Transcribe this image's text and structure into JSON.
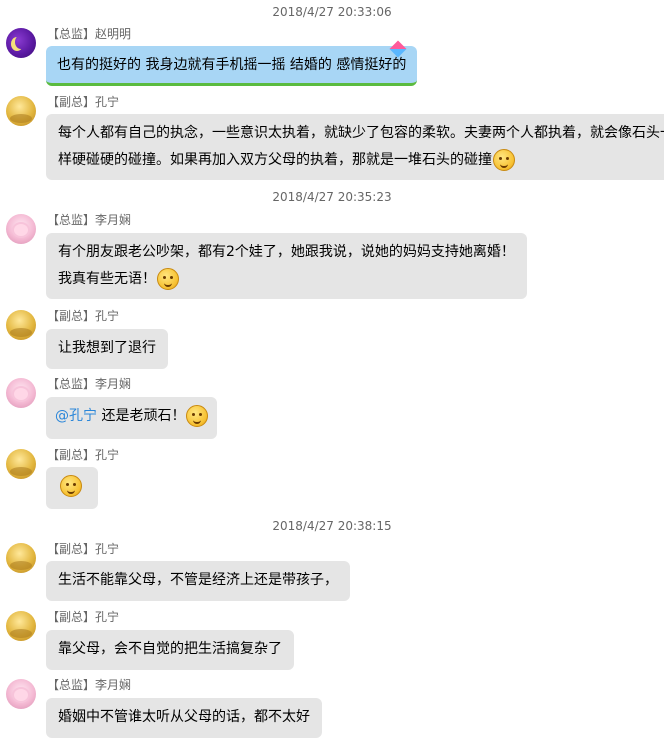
{
  "timestamps": [
    "2018/4/27 20:33:06",
    "2018/4/27 20:35:23",
    "2018/4/27 20:38:15"
  ],
  "messages": [
    {
      "sender": "【总监】赵明明",
      "text": "也有的挺好的 我身边就有手机摇一摇 结婚的 感情挺好的"
    },
    {
      "sender": "【副总】孔宁",
      "line1": "每个人都有自己的执念，一些意识太执着，就缺少了包容的柔软。夫妻两个人都执着，就会像石头一",
      "line2": "样硬碰硬的碰撞。如果再加入双方父母的执着，那就是一堆石头的碰撞"
    },
    {
      "sender": "【总监】李月娴",
      "line1": "有个朋友跟老公吵架，都有2个娃了，她跟我说，说她的妈妈支持她离婚！",
      "line2": "我真有些无语！"
    },
    {
      "sender": "【副总】孔宁",
      "text": "让我想到了退行"
    },
    {
      "sender": "【总监】李月娴",
      "mention": "@孔宁",
      "text": "还是老顽石！"
    },
    {
      "sender": "【副总】孔宁"
    },
    {
      "sender": "【副总】孔宁",
      "text": "生活不能靠父母，不管是经济上还是带孩子，"
    },
    {
      "sender": "【副总】孔宁",
      "text": "靠父母，会不自觉的把生活搞复杂了"
    },
    {
      "sender": "【总监】李月娴",
      "text": "婚姻中不管谁太听从父母的话，都不太好"
    }
  ],
  "icons": {
    "avatar_zhao": "moon-avatar",
    "avatar_kong": "golden-avatar",
    "avatar_li": "pink-avatar",
    "emoji": "smiley-emoji-icon"
  },
  "colors": {
    "bubble_gray": "#e5e5e5",
    "bubble_blue": "#a8d6f5",
    "mention": "#2a86d9",
    "timestamp": "#666666"
  }
}
